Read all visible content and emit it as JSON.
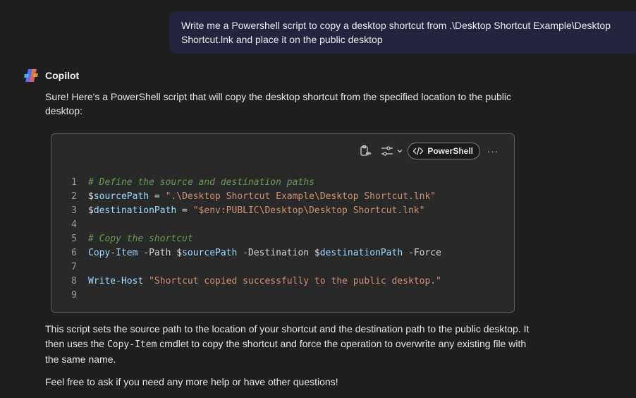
{
  "user_message": {
    "text": "Write me a Powershell script to copy a desktop shortcut from .\\Desktop Shortcut Example\\Desktop Shortcut.lnk and place it on the public desktop"
  },
  "assistant": {
    "name": "Copilot",
    "intro": "Sure! Here's a PowerShell script that will copy the desktop shortcut from the specified location to the public desktop:",
    "code_block": {
      "language": "PowerShell",
      "more_label": "···",
      "lines": [
        {
          "num": "1",
          "comment": "# Define the source and destination paths"
        },
        {
          "num": "2",
          "sigil": "$",
          "var": "sourcePath",
          "op": " = ",
          "str": "\".\\Desktop Shortcut Example\\Desktop Shortcut.lnk\""
        },
        {
          "num": "3",
          "sigil": "$",
          "var": "destinationPath",
          "op": " = ",
          "str": "\"$env:PUBLIC\\Desktop\\Desktop Shortcut.lnk\""
        },
        {
          "num": "4"
        },
        {
          "num": "5",
          "comment": "# Copy the shortcut"
        },
        {
          "num": "6",
          "cmd": "Copy-Item",
          "p1": " -Path ",
          "s1": "$",
          "v1": "sourcePath",
          "p2": " -Destination ",
          "s2": "$",
          "v2": "destinationPath",
          "p3": " -Force"
        },
        {
          "num": "7"
        },
        {
          "num": "8",
          "cmd": "Write-Host",
          "p1": " ",
          "str": "\"Shortcut copied successfully to the public desktop.\""
        },
        {
          "num": "9"
        }
      ]
    },
    "outro_before": "This script sets the source path to the location of your shortcut and the destination path to the public desktop. It then uses the ",
    "outro_code": "Copy-Item",
    "outro_after": " cmdlet to copy the shortcut and force the operation to overwrite any existing file with the same name.",
    "closing": "Feel free to ask if you need any more help or have other questions!"
  },
  "icons": {
    "copy": "clipboard-code-icon",
    "settings": "sliders-icon",
    "dropdown": "chevron-down-icon",
    "language": "code-brackets-icon",
    "logo": "copilot-logo-icon"
  },
  "colors": {
    "background": "#1f1f1f",
    "user_bubble": "#222440",
    "code_background": "#292929",
    "comment": "#6a9955",
    "variable": "#9cdcfe",
    "string": "#ce9178"
  }
}
